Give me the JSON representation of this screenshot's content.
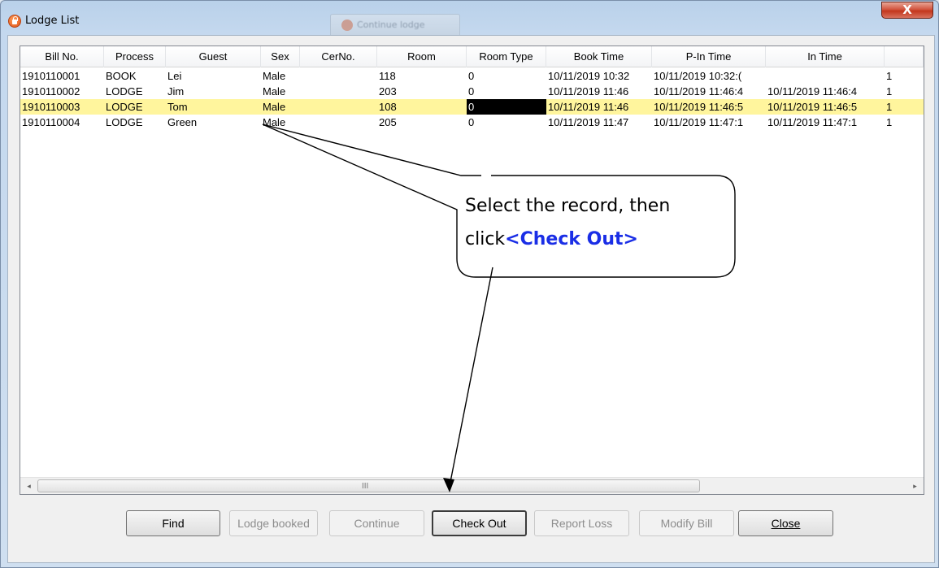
{
  "window": {
    "title": "Lodge List",
    "background_tab_title": "Continue lodge",
    "close_glyph": "X"
  },
  "table": {
    "columns": [
      "Bill No.",
      "Process",
      "Guest",
      "Sex",
      "CerNo.",
      "Room",
      "Room Type",
      "Book Time",
      "P-In Time",
      "In Time",
      ""
    ],
    "rows": [
      [
        "1910110001",
        "BOOK",
        "Lei",
        "Male",
        "",
        "118",
        "0",
        "10/11/2019 10:32",
        "10/11/2019 10:32:(",
        "",
        "1"
      ],
      [
        "1910110002",
        "LODGE",
        "Jim",
        "Male",
        "",
        "203",
        "0",
        "10/11/2019 11:46",
        "10/11/2019 11:46:4",
        "10/11/2019 11:46:4",
        "1"
      ],
      [
        "1910110003",
        "LODGE",
        "Tom",
        "Male",
        "",
        "108",
        "0",
        "10/11/2019 11:46",
        "10/11/2019 11:46:5",
        "10/11/2019 11:46:5",
        "1"
      ],
      [
        "1910110004",
        "LODGE",
        "Green",
        "Male",
        "",
        "205",
        "0",
        "10/11/2019 11:47",
        "10/11/2019 11:47:1",
        "10/11/2019 11:47:1",
        "1"
      ]
    ],
    "selected_row_index": 2,
    "focused_cell": "Room Type",
    "selected_row_color": "#fff59d"
  },
  "scrollbar": {
    "left_arrow": "◂",
    "right_arrow": "▸",
    "grip": "III"
  },
  "buttons": {
    "find": "Find",
    "lodge_booked": "Lodge booked",
    "continue": "Continue",
    "check_out": "Check Out",
    "report_loss": "Report Loss",
    "modify_bill": "Modify Bill",
    "close": "Close"
  },
  "callout": {
    "line1": "Select the record, then",
    "line2_prefix": "click",
    "line2_highlight": "<Check Out>",
    "highlight_color": "#1a2ee6"
  },
  "icons": {
    "app": "lock-icon",
    "close": "close-icon"
  }
}
